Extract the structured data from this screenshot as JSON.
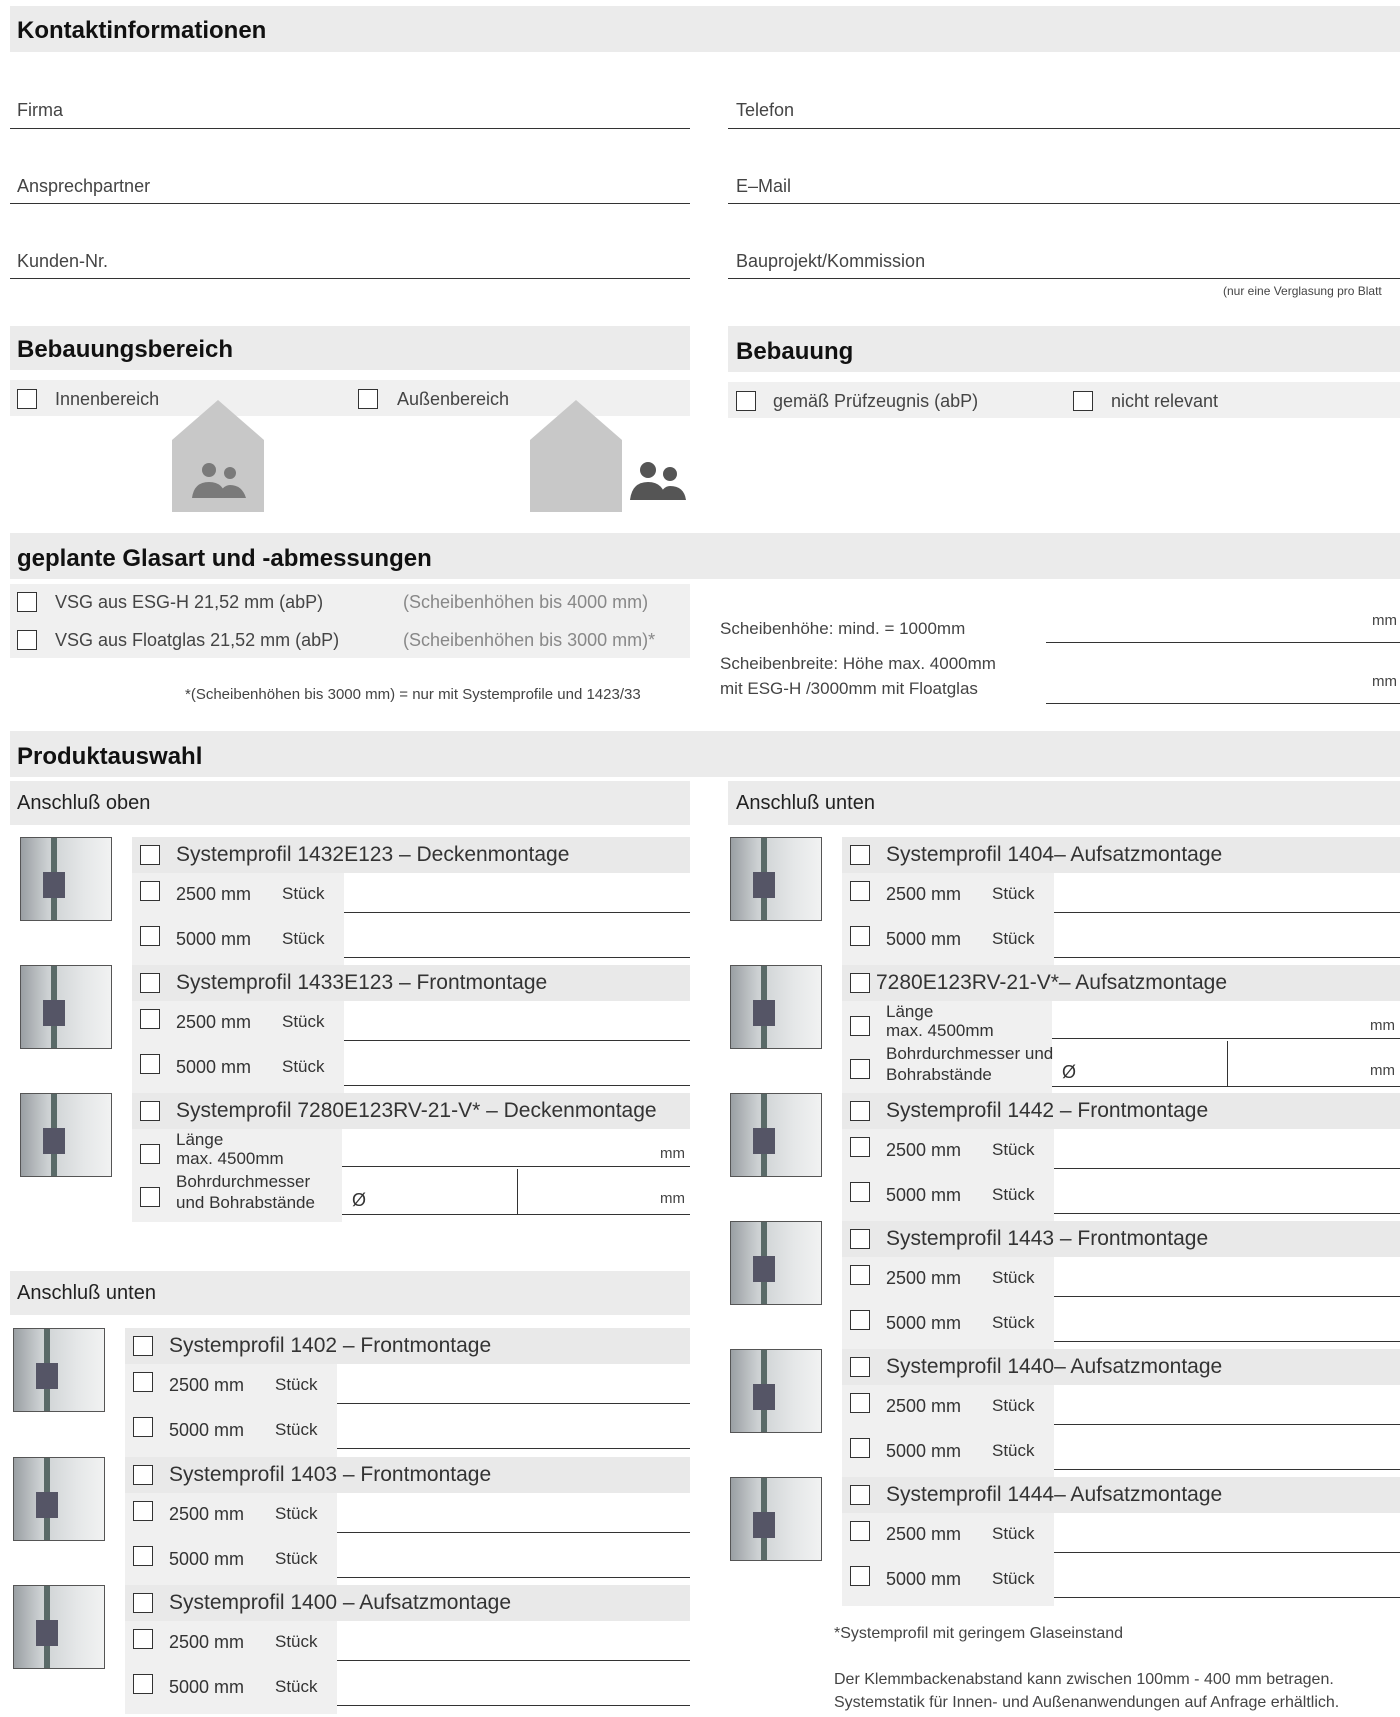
{
  "contact": {
    "title": "Kontaktinformationen",
    "firma": "Firma",
    "ansprech": "Ansprechpartner",
    "kunden": "Kunden-Nr.",
    "telefon": "Telefon",
    "email": "E–Mail",
    "bauprojekt": "Bauprojekt/Kommission",
    "note": "(nur eine Verglasung pro Blatt"
  },
  "bereich": {
    "title": "Bebauungsbereich",
    "innen": "Innenbereich",
    "aussen": "Außenbereich"
  },
  "bebauung": {
    "title": "Bebauung",
    "gemaess": "gemäß Prüfzeugnis (abP)",
    "nicht": "nicht relevant"
  },
  "glas": {
    "title": "geplante Glasart und -abmessungen",
    "opt1": "VSG aus ESG-H 21,52 mm (abP)",
    "opt1_note": "(Scheibenhöhen bis 4000 mm)",
    "opt2": "VSG aus Floatglas 21,52 mm (abP)",
    "opt2_note": "(Scheibenhöhen bis 3000 mm)*",
    "footnote": "*(Scheibenhöhen bis 3000 mm) = nur mit Systemprofile und 1423/33",
    "hoehe": "Scheibenhöhe: mind. = 1000mm",
    "breite1": "Scheibenbreite: Höhe max. 4000mm",
    "breite2": "mit ESG-H /3000mm mit Floatglas",
    "mm": "mm"
  },
  "produkt": {
    "title": "Produktauswahl",
    "oben_title": "Anschluß oben",
    "unten_title": "Anschluß unten",
    "unten_right_title": "Anschluß unten",
    "len2500": "2500 mm",
    "len5000": "5000 mm",
    "stueck": "Stück",
    "laenge1": "Länge",
    "laenge2": "max. 4500mm",
    "bohr1_left": "Bohrdurchmesser",
    "bohr2_left": "und Bohrabstände",
    "bohr1_right": "Bohrdurchmesser und",
    "bohr2_right": "Bohrabstände",
    "diameter": "Ø",
    "mm": "mm",
    "oben": [
      "Systemprofil 1432E123 – Deckenmontage",
      "Systemprofil 1433E123 – Frontmontage",
      "Systemprofil 7280E123RV-21-V* – Deckenmontage"
    ],
    "unten_left": [
      "Systemprofil 1402 – Frontmontage",
      "Systemprofil 1403 – Frontmontage",
      "Systemprofil 1400 – Aufsatzmontage"
    ],
    "unten_right": [
      "Systemprofil 1404– Aufsatzmontage",
      "7280E123RV-21-V*– Aufsatzmontage",
      "Systemprofil 1442 – Frontmontage",
      "Systemprofil 1443 – Frontmontage",
      "Systemprofil 1440– Aufsatzmontage",
      "Systemprofil 1444– Aufsatzmontage"
    ],
    "footnote": "*Systemprofil mit geringem Glaseinstand",
    "closing1": "Der Klemmbackenabstand kann zwischen 100mm - 400 mm betragen.",
    "closing2": "Systemstatik für Innen- und Außenanwendungen auf Anfrage erhältlich."
  }
}
